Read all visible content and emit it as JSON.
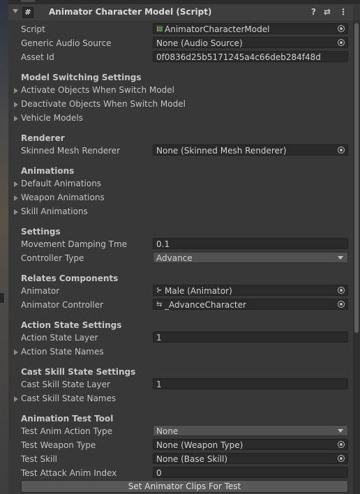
{
  "component": {
    "title": "Animator Character Model (Script)",
    "checkbox_glyph": "#",
    "icons": [
      "help-icon",
      "preset-icon",
      "more-icon"
    ]
  },
  "fields": {
    "script": {
      "label": "Script",
      "value": "AnimatorCharacterModel"
    },
    "generic_audio_source": {
      "label": "Generic Audio Source",
      "value": "None (Audio Source)"
    },
    "asset_id": {
      "label": "Asset Id",
      "value": "0f0836d25b5171245a4c66deb284f48d"
    }
  },
  "model_switching": {
    "header": "Model Switching Settings",
    "items": [
      "Activate Objects When Switch Model",
      "Deactivate Objects When Switch Model",
      "Vehicle Models"
    ]
  },
  "renderer": {
    "header": "Renderer",
    "skinned_mesh": {
      "label": "Skinned Mesh Renderer",
      "value": "None (Skinned Mesh Renderer)"
    }
  },
  "animations": {
    "header": "Animations",
    "items": [
      "Default Animations",
      "Weapon Animations",
      "Skill Animations"
    ]
  },
  "settings": {
    "header": "Settings",
    "movement_damping": {
      "label": "Movement Damping Tme",
      "value": "0.1"
    },
    "controller_type": {
      "label": "Controller Type",
      "value": "Advance"
    }
  },
  "relates": {
    "header": "Relates Components",
    "animator": {
      "label": "Animator",
      "value": "Male (Animator)"
    },
    "animator_controller": {
      "label": "Animator Controller",
      "value": "_AdvanceCharacter"
    }
  },
  "action_state": {
    "header": "Action State Settings",
    "layer": {
      "label": "Action State Layer",
      "value": "1"
    },
    "names": "Action State Names"
  },
  "cast_skill": {
    "header": "Cast Skill State Settings",
    "layer": {
      "label": "Cast Skill State Layer",
      "value": "1"
    },
    "names": "Cast Skill State Names"
  },
  "test_tool": {
    "header": "Animation Test Tool",
    "action_type": {
      "label": "Test Anim Action Type",
      "value": "None"
    },
    "weapon_type": {
      "label": "Test Weapon Type",
      "value": "None (Weapon Type)"
    },
    "skill": {
      "label": "Test Skill",
      "value": "None (Base Skill)"
    },
    "attack_index": {
      "label": "Test Attack Anim Index",
      "value": "0"
    },
    "button": "Set Animator Clips For Test"
  },
  "colors": {
    "panel": "#383838",
    "field": "#2a2a2a",
    "header": "#3e3e3e",
    "button": "#585858"
  }
}
